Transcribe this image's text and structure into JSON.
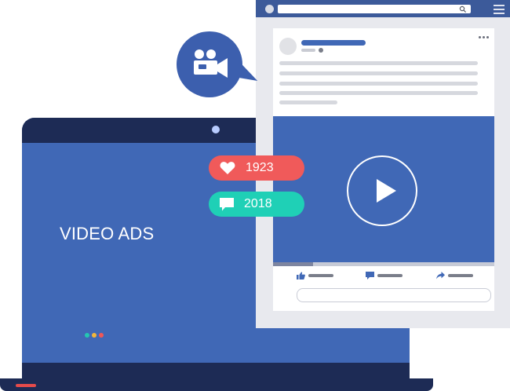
{
  "laptop": {
    "screen_text": "VIDEO ADS",
    "dot_colors": [
      "#24c7b1",
      "#f3b63a",
      "#ef5757"
    ],
    "lid_color": "#4068b6",
    "bezel_color": "#1d2b55"
  },
  "browser": {
    "bar_color": "#3c5a9a",
    "icons": [
      "search-icon",
      "hamburger-menu-icon"
    ]
  },
  "post": {
    "text_line_widths": [
      0.95,
      0.95,
      0.95,
      0.95,
      0.28
    ],
    "video_progress": 0.18,
    "actions": [
      "thumbs-up-icon",
      "comment-icon",
      "share-icon"
    ]
  },
  "stats": {
    "likes": "1923",
    "comments": "2018",
    "like_color": "#f05a5a",
    "comment_color": "#1fd0b6"
  },
  "camera_bubble": {
    "icon": "video-camera-icon",
    "color": "#3c5fae"
  }
}
